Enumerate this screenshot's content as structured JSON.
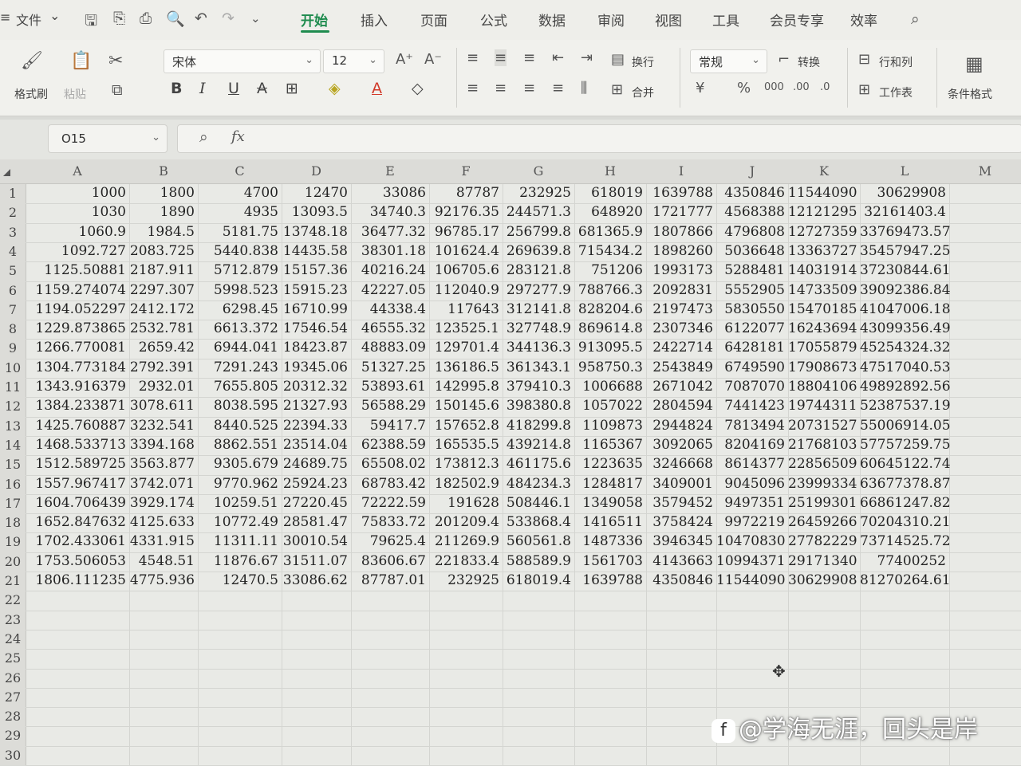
{
  "menubar": {
    "menu_icon": "≡",
    "file_label": "文件",
    "file_arrow": "⌄",
    "tabs": [
      "开始",
      "插入",
      "页面",
      "公式",
      "数据",
      "审阅",
      "视图",
      "工具",
      "会员专享",
      "效率"
    ],
    "active_tab": "开始"
  },
  "ribbon": {
    "format_painter": "格式刷",
    "paste": "粘贴",
    "font_name": "宋体",
    "font_size": "12",
    "wrap_text": "换行",
    "merge": "合并",
    "number_format": "常规",
    "convert": "转换",
    "row_col": "行和列",
    "worksheet": "工作表",
    "cond_format": "条件格式"
  },
  "formula_bar": {
    "name_box": "O15",
    "fx": "fx"
  },
  "sheet": {
    "columns": [
      "A",
      "B",
      "C",
      "D",
      "E",
      "F",
      "G",
      "H",
      "I",
      "J",
      "K",
      "L",
      "M"
    ],
    "rows": [
      [
        "1000",
        "1800",
        "4700",
        "12470",
        "33086",
        "87787",
        "232925",
        "618019",
        "1639788",
        "4350846",
        "11544090",
        "30629908"
      ],
      [
        "1030",
        "1890",
        "4935",
        "13093.5",
        "34740.3",
        "92176.35",
        "244571.3",
        "648920",
        "1721777",
        "4568388",
        "12121295",
        "32161403.4"
      ],
      [
        "1060.9",
        "1984.5",
        "5181.75",
        "13748.18",
        "36477.32",
        "96785.17",
        "256799.8",
        "681365.9",
        "1807866",
        "4796808",
        "12727359",
        "33769473.57"
      ],
      [
        "1092.727",
        "2083.725",
        "5440.838",
        "14435.58",
        "38301.18",
        "101624.4",
        "269639.8",
        "715434.2",
        "1898260",
        "5036648",
        "13363727",
        "35457947.25"
      ],
      [
        "1125.50881",
        "2187.911",
        "5712.879",
        "15157.36",
        "40216.24",
        "106705.6",
        "283121.8",
        "751206",
        "1993173",
        "5288481",
        "14031914",
        "37230844.61"
      ],
      [
        "1159.274074",
        "2297.307",
        "5998.523",
        "15915.23",
        "42227.05",
        "112040.9",
        "297277.9",
        "788766.3",
        "2092831",
        "5552905",
        "14733509",
        "39092386.84"
      ],
      [
        "1194.052297",
        "2412.172",
        "6298.45",
        "16710.99",
        "44338.4",
        "117643",
        "312141.8",
        "828204.6",
        "2197473",
        "5830550",
        "15470185",
        "41047006.18"
      ],
      [
        "1229.873865",
        "2532.781",
        "6613.372",
        "17546.54",
        "46555.32",
        "123525.1",
        "327748.9",
        "869614.8",
        "2307346",
        "6122077",
        "16243694",
        "43099356.49"
      ],
      [
        "1266.770081",
        "2659.42",
        "6944.041",
        "18423.87",
        "48883.09",
        "129701.4",
        "344136.3",
        "913095.5",
        "2422714",
        "6428181",
        "17055879",
        "45254324.32"
      ],
      [
        "1304.773184",
        "2792.391",
        "7291.243",
        "19345.06",
        "51327.25",
        "136186.5",
        "361343.1",
        "958750.3",
        "2543849",
        "6749590",
        "17908673",
        "47517040.53"
      ],
      [
        "1343.916379",
        "2932.01",
        "7655.805",
        "20312.32",
        "53893.61",
        "142995.8",
        "379410.3",
        "1006688",
        "2671042",
        "7087070",
        "18804106",
        "49892892.56"
      ],
      [
        "1384.233871",
        "3078.611",
        "8038.595",
        "21327.93",
        "56588.29",
        "150145.6",
        "398380.8",
        "1057022",
        "2804594",
        "7441423",
        "19744311",
        "52387537.19"
      ],
      [
        "1425.760887",
        "3232.541",
        "8440.525",
        "22394.33",
        "59417.7",
        "157652.8",
        "418299.8",
        "1109873",
        "2944824",
        "7813494",
        "20731527",
        "55006914.05"
      ],
      [
        "1468.533713",
        "3394.168",
        "8862.551",
        "23514.04",
        "62388.59",
        "165535.5",
        "439214.8",
        "1165367",
        "3092065",
        "8204169",
        "21768103",
        "57757259.75"
      ],
      [
        "1512.589725",
        "3563.877",
        "9305.679",
        "24689.75",
        "65508.02",
        "173812.3",
        "461175.6",
        "1223635",
        "3246668",
        "8614377",
        "22856509",
        "60645122.74"
      ],
      [
        "1557.967417",
        "3742.071",
        "9770.962",
        "25924.23",
        "68783.42",
        "182502.9",
        "484234.3",
        "1284817",
        "3409001",
        "9045096",
        "23999334",
        "63677378.87"
      ],
      [
        "1604.706439",
        "3929.174",
        "10259.51",
        "27220.45",
        "72222.59",
        "191628",
        "508446.1",
        "1349058",
        "3579452",
        "9497351",
        "25199301",
        "66861247.82"
      ],
      [
        "1652.847632",
        "4125.633",
        "10772.49",
        "28581.47",
        "75833.72",
        "201209.4",
        "533868.4",
        "1416511",
        "3758424",
        "9972219",
        "26459266",
        "70204310.21"
      ],
      [
        "1702.433061",
        "4331.915",
        "11311.11",
        "30010.54",
        "79625.4",
        "211269.9",
        "560561.8",
        "1487336",
        "3946345",
        "10470830",
        "27782229",
        "73714525.72"
      ],
      [
        "1753.506053",
        "4548.51",
        "11876.67",
        "31511.07",
        "83606.67",
        "221833.4",
        "588589.9",
        "1561703",
        "4143663",
        "10994371",
        "29171340",
        "77400252"
      ],
      [
        "1806.111235",
        "4775.936",
        "12470.5",
        "33086.62",
        "87787.01",
        "232925",
        "618019.4",
        "1639788",
        "4350846",
        "11544090",
        "30629908",
        "81270264.61"
      ]
    ],
    "row_numbers": [
      "1",
      "2",
      "3",
      "4",
      "5",
      "6",
      "7",
      "8",
      "9",
      "10",
      "11",
      "12",
      "13",
      "14",
      "15",
      "16",
      "17",
      "18",
      "19",
      "20",
      "21",
      "22",
      "23",
      "24",
      "25",
      "26",
      "27",
      "28",
      "29",
      "30"
    ]
  },
  "watermark": {
    "logo": "f",
    "text": "@学海无涯，回头是岸"
  },
  "icons": {
    "search": "search-icon",
    "save": "save-icon",
    "print": "print-icon",
    "undo": "undo-icon",
    "redo": "redo-icon",
    "cursor": "move-cursor-icon"
  }
}
